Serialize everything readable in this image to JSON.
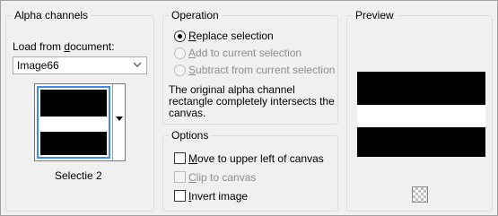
{
  "alpha_channels": {
    "title": "Alpha channels",
    "load_label_pre": "Load from ",
    "load_label_ul": "d",
    "load_label_post": "ocument:",
    "document_value": "Image66",
    "selection_name": "Selectie 2"
  },
  "operation": {
    "title": "Operation",
    "options": [
      {
        "pre": "",
        "ul": "R",
        "post": "eplace selection",
        "selected": true,
        "enabled": true
      },
      {
        "pre": "",
        "ul": "A",
        "post": "dd to current selection",
        "selected": false,
        "enabled": false
      },
      {
        "pre": "",
        "ul": "S",
        "post": "ubtract from current selection",
        "selected": false,
        "enabled": false
      }
    ],
    "info_line1": "The original alpha channel",
    "info_line2": "rectangle completely intersects the",
    "info_line3": "canvas."
  },
  "options": {
    "title": "Options",
    "items": [
      {
        "pre": "",
        "ul": "M",
        "post": "ove to upper left of canvas",
        "checked": false,
        "enabled": true
      },
      {
        "pre": "",
        "ul": "C",
        "post": "lip to canvas",
        "checked": false,
        "enabled": false
      },
      {
        "pre": "",
        "ul": "I",
        "post": "nvert image",
        "checked": false,
        "enabled": true
      }
    ]
  },
  "preview": {
    "title": "Preview",
    "checker_icon": "transparency-checker-icon"
  }
}
